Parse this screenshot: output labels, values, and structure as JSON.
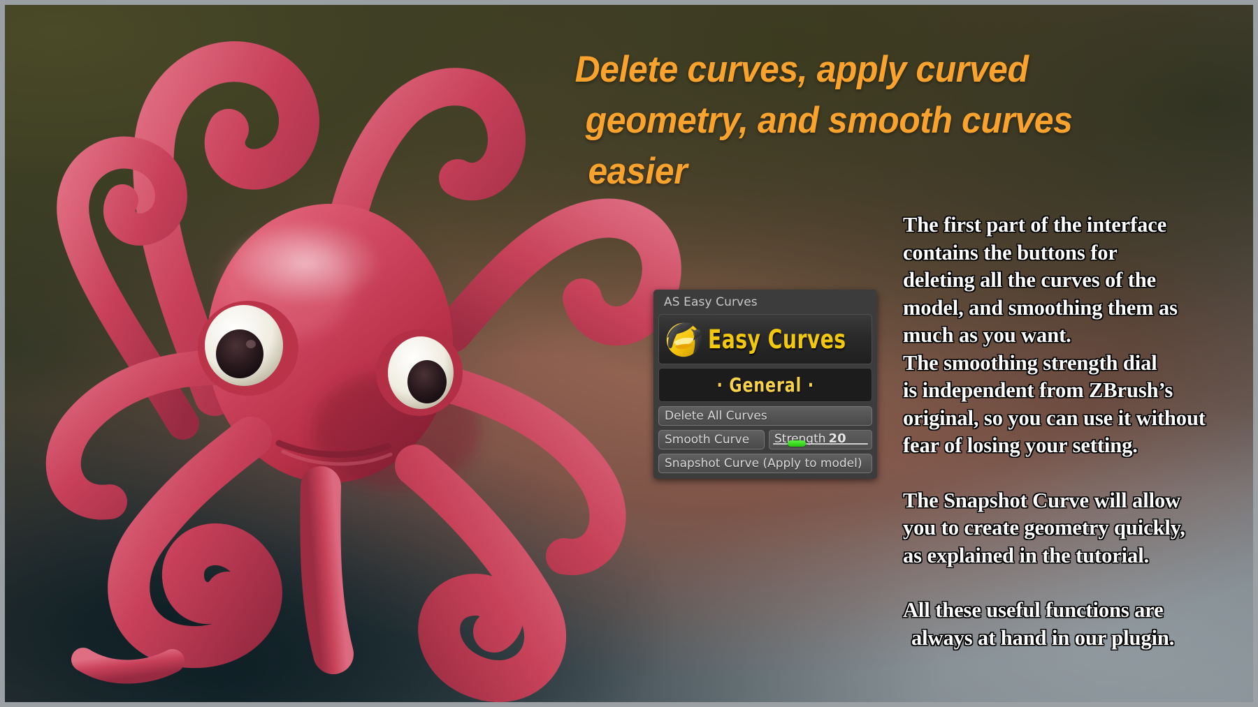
{
  "headline": {
    "line1": "Delete curves, apply curved",
    "line2": "geometry, and smooth curves",
    "line3": "easier",
    "color": "#f9a32e"
  },
  "description": {
    "paragraph1_line1": "The first part of the interface",
    "paragraph1_line2": "contains the buttons for",
    "paragraph1_line3": "deleting all the curves of the",
    "paragraph1_line4": "model, and smoothing them as",
    "paragraph1_line5": "much as you want.",
    "paragraph1_line6": "The smoothing strength dial",
    "paragraph1_line7": "is independent from ZBrush’s",
    "paragraph1_line8": "original, so you can use it without",
    "paragraph1_line9": "fear of losing your setting.",
    "paragraph2_line1": "The Snapshot Curve will allow",
    "paragraph2_line2": "you to create geometry quickly,",
    "paragraph2_line3": "as explained in the tutorial.",
    "paragraph3_line1": "All these useful functions are",
    "paragraph3_line2": "always at hand in our plugin."
  },
  "panel": {
    "title": "AS Easy Curves",
    "logo_text": "Easy Curves",
    "logo_icon": "easy-curves-swoosh-icon",
    "logo_color": "#f2c80f",
    "section_header": "· General ·",
    "section_header_color": "#f7d24a",
    "buttons": {
      "delete_all_curves": "Delete All Curves",
      "smooth_curve": "Smooth Curve",
      "snapshot_curve": "Snapshot Curve (Apply to model)"
    },
    "slider": {
      "label": "Strength",
      "value": "20",
      "handle_color": "#35d40f",
      "percent": 20
    }
  },
  "artwork": {
    "subject": "red-octopus-3d-render",
    "body_color": "#c53d54",
    "body_shadow_color": "#8e2236",
    "eye_color": "#f2efe4",
    "pupil_color": "#2a1a1a"
  }
}
